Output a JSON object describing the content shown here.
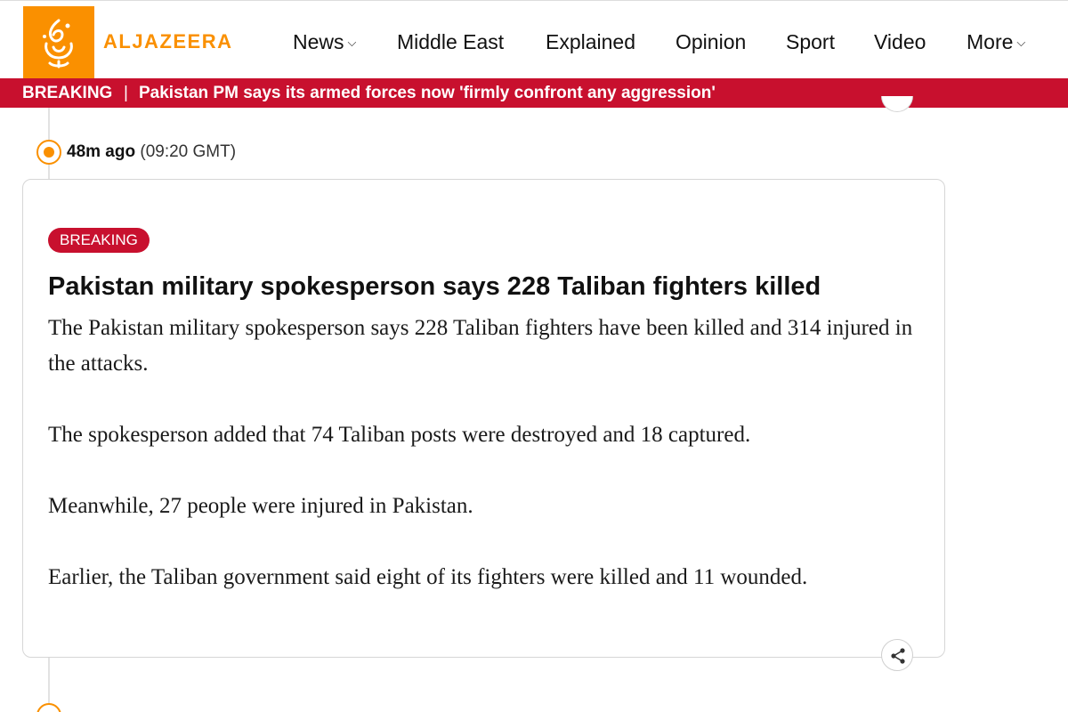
{
  "header": {
    "brand": "ALJAZEERA",
    "logo_icon": "aljazeera-calligraphy-logo",
    "nav": [
      {
        "label": "News",
        "dropdown": true
      },
      {
        "label": "Middle East",
        "dropdown": false
      },
      {
        "label": "Explained",
        "dropdown": false
      },
      {
        "label": "Opinion",
        "dropdown": false
      },
      {
        "label": "Sport",
        "dropdown": false
      },
      {
        "label": "Video",
        "dropdown": false
      },
      {
        "label": "More",
        "dropdown": true
      }
    ]
  },
  "breaking_bar": {
    "label": "BREAKING",
    "separator": "|",
    "headline": "Pakistan PM says its armed forces now 'firmly confront any aggression'"
  },
  "update": {
    "time_ago": "48m ago",
    "time_gmt": "(09:20 GMT)",
    "badge": "BREAKING",
    "title": "Pakistan military spokesperson says 228 Taliban fighters killed",
    "paragraphs": [
      "The Pakistan military spokesperson says 228 Taliban fighters have been killed and 314 injured in the attacks.",
      "The spokesperson added that 74 Taliban posts were destroyed and 18 captured.",
      "Meanwhile, 27 people were injured in Pakistan.",
      "Earlier, the Taliban government said eight of its fighters were killed and 11 wounded."
    ],
    "share_icon": "share-icon"
  },
  "colors": {
    "brand_orange": "#fa9000",
    "breaking_red": "#c8102e"
  }
}
